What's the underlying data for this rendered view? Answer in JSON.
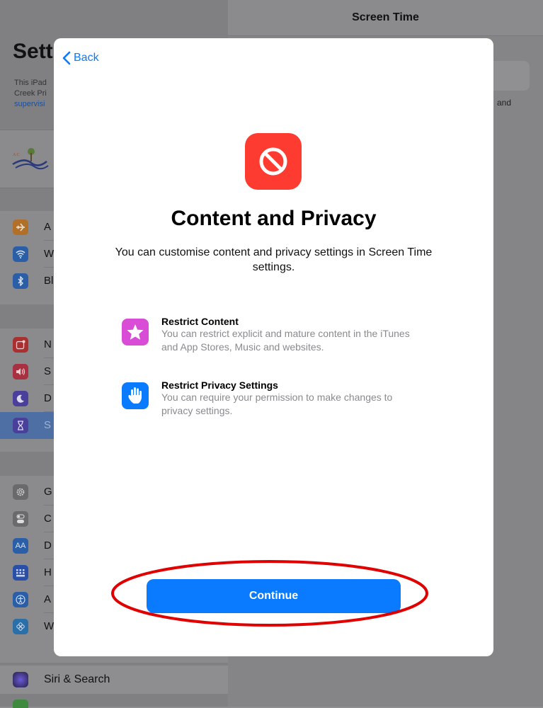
{
  "background": {
    "detail_title": "Screen Time",
    "detail_fragment": "and",
    "settings_title": "Sett",
    "settings_sub_lines": [
      "This iPad",
      "Creek Pri",
      "supervisi"
    ],
    "groups": [
      {
        "rows": [
          {
            "icon": "airplane-icon",
            "color": "#b0702a",
            "label": "A"
          },
          {
            "icon": "wifi-icon",
            "color": "#2a5fa8",
            "label": "W"
          },
          {
            "icon": "bluetooth-icon",
            "color": "#2a5fa8",
            "label": "Bl"
          }
        ]
      },
      {
        "rows": [
          {
            "icon": "notifications-icon",
            "color": "#a83030",
            "label": "N"
          },
          {
            "icon": "sounds-icon",
            "color": "#a83040",
            "label": "S"
          },
          {
            "icon": "moon-icon",
            "color": "#4a3f9a",
            "label": "D"
          },
          {
            "icon": "hourglass-icon",
            "color": "#4a3f9a",
            "label": "S"
          }
        ]
      },
      {
        "rows": [
          {
            "icon": "gear-icon",
            "color": "#6a6a6c",
            "label": "G"
          },
          {
            "icon": "toggles-icon",
            "color": "#6a6a6c",
            "label": "C"
          },
          {
            "icon": "text-size-icon",
            "color": "#2a5fa8",
            "label": "D"
          },
          {
            "icon": "home-grid-icon",
            "color": "#2a4fa8",
            "label": "H"
          },
          {
            "icon": "accessibility-icon",
            "color": "#2a5fa8",
            "label": "A"
          },
          {
            "icon": "wallpaper-icon",
            "color": "#2a6fa8",
            "label": "W"
          }
        ]
      }
    ],
    "siri_label": "Siri & Search"
  },
  "modal": {
    "back_label": "Back",
    "title": "Content and Privacy",
    "description": "You can customise content and privacy settings in Screen Time settings.",
    "features": [
      {
        "icon": "star-icon",
        "color": "#d94cd6",
        "title": "Restrict Content",
        "description": "You can restrict explicit and mature content in the iTunes and App Stores, Music and websites."
      },
      {
        "icon": "hand-icon",
        "color": "#0a7aff",
        "title": "Restrict Privacy Settings",
        "description": "You can require your permission to make changes to privacy settings."
      }
    ],
    "continue_label": "Continue"
  },
  "colors": {
    "accent": "#0a7aff",
    "hero": "#fe3b30",
    "highlight": "#e00000"
  }
}
